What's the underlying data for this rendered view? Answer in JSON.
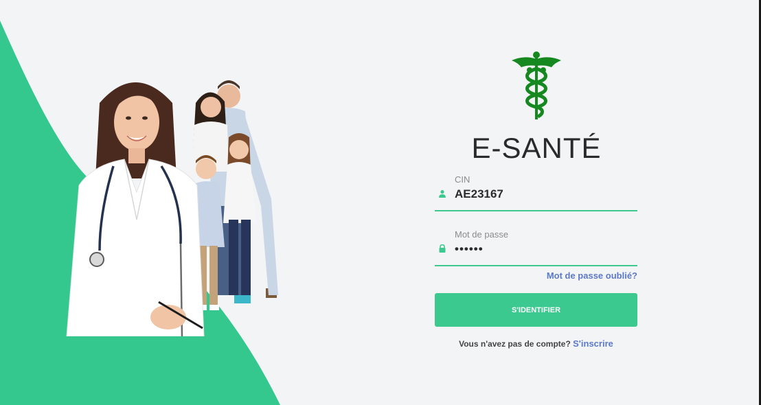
{
  "brand": {
    "title": "E-SANTÉ",
    "logo_icon": "caduceus-icon",
    "logo_color": "#15891f"
  },
  "form": {
    "cin": {
      "label": "CIN",
      "value": "AE23167",
      "icon": "user-icon"
    },
    "password": {
      "label": "Mot de passe",
      "value": "••••••",
      "icon": "lock-icon"
    },
    "forgot_label": "Mot de passe oublié?",
    "submit_label": "S'IDENTIFIER",
    "signup_prompt": "Vous n'avez pas de compte?",
    "signup_link": "S'inscrire"
  },
  "colors": {
    "accent": "#3cc98f",
    "link": "#5b79c9",
    "background": "#f3f4f6"
  }
}
